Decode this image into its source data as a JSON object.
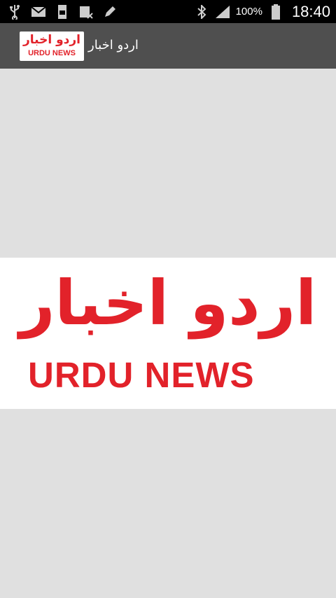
{
  "status_bar": {
    "icons_left": [
      "usb-icon",
      "gmail-icon",
      "sd-card-icon",
      "sim-calendar-icon",
      "edit-icon"
    ],
    "icons_right": [
      "bluetooth-icon",
      "signal-icon",
      "battery-icon"
    ],
    "battery": "100%",
    "time": "18:40"
  },
  "action_bar": {
    "logo_urdu": "اردو اخبار",
    "logo_english": "URDU NEWS",
    "title": "اردو اخبار"
  },
  "splash": {
    "urdu": "اردو اخبار",
    "english": "URDU NEWS"
  },
  "colors": {
    "brand_red": "#e2222a",
    "action_bar": "#4f4f4f",
    "background": "#e0e0e0",
    "status_bar": "#000000"
  }
}
